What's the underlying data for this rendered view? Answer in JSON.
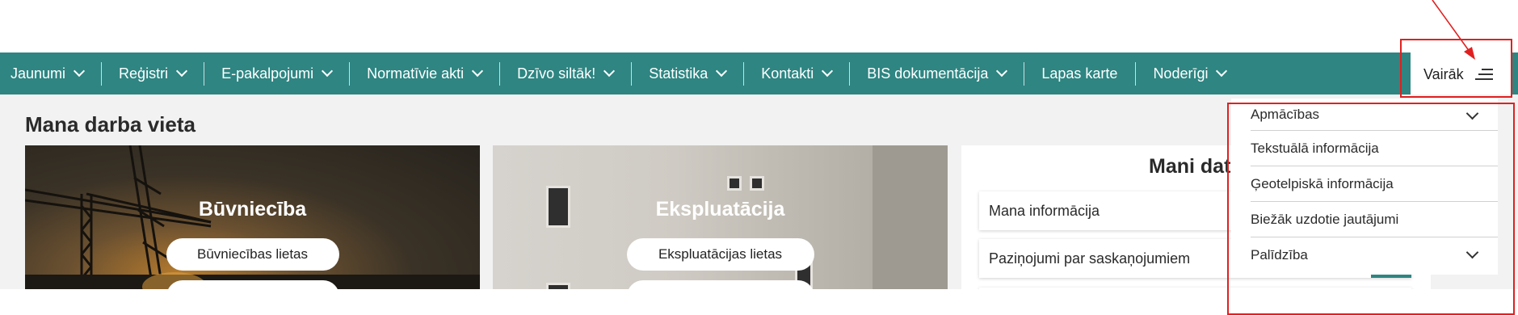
{
  "nav": {
    "items": [
      {
        "label": "Jaunumi",
        "has_dropdown": true
      },
      {
        "label": "Reģistri",
        "has_dropdown": true
      },
      {
        "label": "E-pakalpojumi",
        "has_dropdown": true
      },
      {
        "label": "Normatīvie akti",
        "has_dropdown": true
      },
      {
        "label": "Dzīvo siltāk!",
        "has_dropdown": true
      },
      {
        "label": "Statistika",
        "has_dropdown": true
      },
      {
        "label": "Kontakti",
        "has_dropdown": true
      },
      {
        "label": "BIS dokumentācija",
        "has_dropdown": true
      },
      {
        "label": "Lapas karte",
        "has_dropdown": false
      },
      {
        "label": "Noderīgi",
        "has_dropdown": true
      }
    ],
    "more_label": "Vairāk",
    "more_icon": "hamburger-menu-icon"
  },
  "main": {
    "title": "Mana darba vieta",
    "cards": [
      {
        "title": "Būvniecība",
        "button_label": "Būvniecības lietas"
      },
      {
        "title": "Ekspluatācija",
        "button_label": "Ekspluatācijas lietas"
      }
    ],
    "data_panel": {
      "title": "Mani dat",
      "rows": [
        "Mana informācija",
        "Paziņojumi par saskaņojumiem"
      ]
    }
  },
  "more_menu": {
    "items": [
      {
        "label": "Apmācības",
        "expandable": true
      },
      {
        "label": "Tekstuālā informācija",
        "expandable": false
      },
      {
        "label": "Ģeotelpiskā informācija",
        "expandable": false
      },
      {
        "label": "Biežāk uzdotie jautājumi",
        "expandable": false
      },
      {
        "label": "Palīdzība",
        "expandable": true
      }
    ]
  },
  "colors": {
    "nav_bg": "#2e8582",
    "content_bg": "#f2f2f2",
    "highlight": "#e02020"
  }
}
